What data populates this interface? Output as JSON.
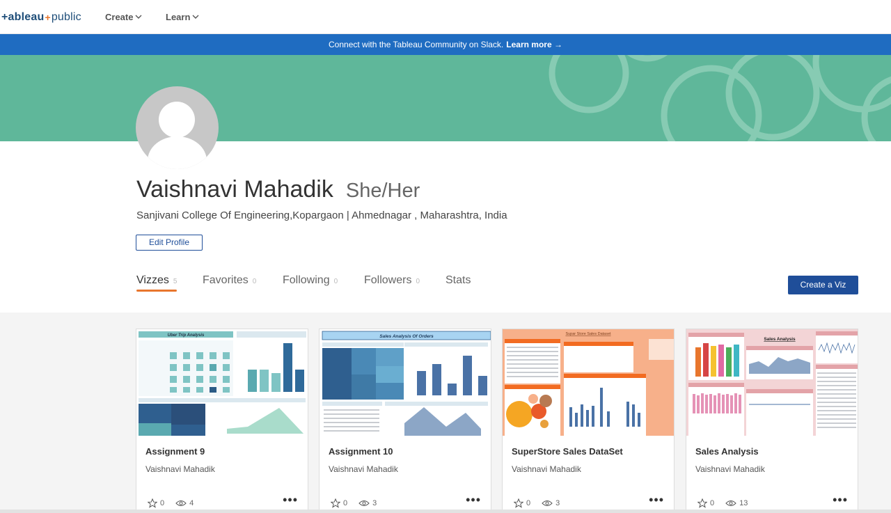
{
  "nav": {
    "logo_part1": "+ableau",
    "logo_plus": "+",
    "logo_part2": "public",
    "create": "Create",
    "learn": "Learn"
  },
  "banner": {
    "text": "Connect with the Tableau Community on Slack.",
    "link": "Learn more →"
  },
  "profile": {
    "name": "Vaishnavi Mahadik",
    "pronouns": "She/Her",
    "bio": "Sanjivani College Of Engineering,Kopargaon | Ahmednagar , Maharashtra, India",
    "edit_button": "Edit Profile"
  },
  "tabs": [
    {
      "label": "Vizzes",
      "count": "5",
      "active": true
    },
    {
      "label": "Favorites",
      "count": "0"
    },
    {
      "label": "Following",
      "count": "0"
    },
    {
      "label": "Followers",
      "count": "0"
    },
    {
      "label": "Stats",
      "count": ""
    }
  ],
  "create_viz": "Create a Viz",
  "cards": [
    {
      "title": "Assignment 9",
      "author": "Vaishnavi Mahadik",
      "favorites": "0",
      "views": "4",
      "thumb_title": "Uber Trip Analysis",
      "accent": "#5aa9b0"
    },
    {
      "title": "Assignment 10",
      "author": "Vaishnavi Mahadik",
      "favorites": "0",
      "views": "3",
      "thumb_title": "Sales Analysis Of Orders",
      "accent": "#2f5f8f"
    },
    {
      "title": "SuperStore Sales DataSet",
      "author": "Vaishnavi Mahadik",
      "favorites": "0",
      "views": "3",
      "thumb_title": "Supar Store Sales Dataset",
      "accent": "#f5a578"
    },
    {
      "title": "Sales Analysis",
      "author": "Vaishnavi Mahadik",
      "favorites": "0",
      "views": "13",
      "thumb_title": "Sales Analysis",
      "accent": "#e3a3a8"
    }
  ],
  "colors": {
    "banner": "#1f6cc1",
    "cover": "#5fb79a",
    "primary_button": "#1f4e99",
    "tab_underline": "#e8762d"
  }
}
